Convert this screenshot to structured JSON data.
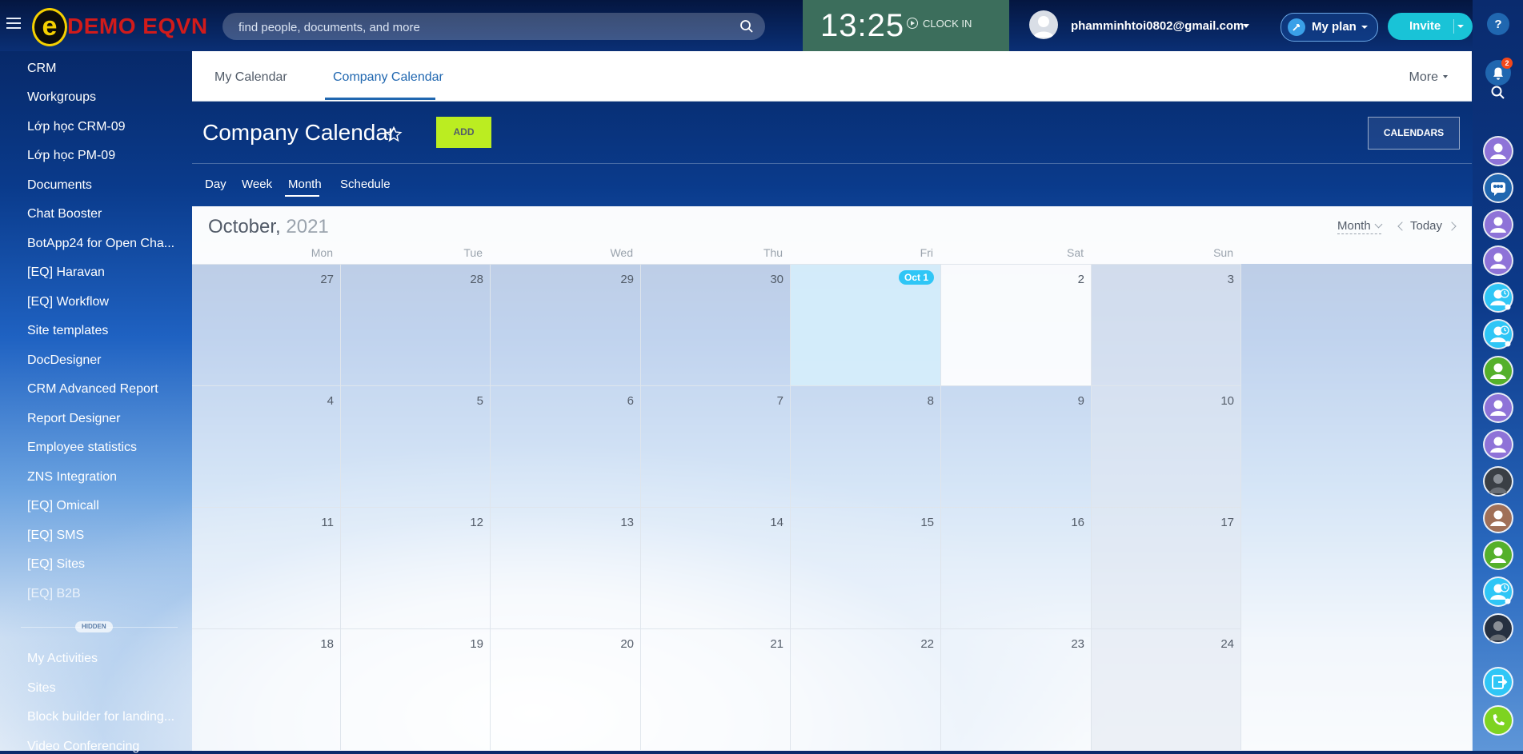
{
  "app": {
    "logo_letter": "e",
    "logo_text": "DEMO EQVN"
  },
  "search": {
    "placeholder": "find people, documents, and more"
  },
  "clock": {
    "time": "13:25",
    "clock_in_label": "CLOCK IN"
  },
  "user": {
    "email": "phamminhtoi0802@gmail.com"
  },
  "header_buttons": {
    "my_plan": "My plan",
    "invite": "Invite"
  },
  "sidebar": {
    "items": [
      {
        "label": "CRM"
      },
      {
        "label": "Workgroups"
      },
      {
        "label": "Lớp học CRM-09"
      },
      {
        "label": "Lớp học PM-09"
      },
      {
        "label": "Documents"
      },
      {
        "label": "Chat Booster"
      },
      {
        "label": "BotApp24 for Open Cha..."
      },
      {
        "label": "[EQ] Haravan"
      },
      {
        "label": "[EQ] Workflow"
      },
      {
        "label": "Site templates"
      },
      {
        "label": "DocDesigner"
      },
      {
        "label": "CRM Advanced Report"
      },
      {
        "label": "Report Designer"
      },
      {
        "label": "Employee statistics"
      },
      {
        "label": "ZNS Integration"
      },
      {
        "label": "[EQ] Omicall"
      },
      {
        "label": "[EQ] SMS"
      },
      {
        "label": "[EQ] Sites"
      },
      {
        "label": "[EQ] B2B"
      }
    ],
    "hidden_label": "HIDDEN",
    "hidden_items": [
      {
        "label": "My Activities"
      },
      {
        "label": "Sites"
      },
      {
        "label": "Block builder for landing..."
      },
      {
        "label": "Video Conferencing"
      }
    ]
  },
  "tabs": {
    "items": [
      {
        "label": "My Calendar"
      },
      {
        "label": "Company Calendar"
      }
    ],
    "more_label": "More"
  },
  "page": {
    "title": "Company Calendar",
    "add_label": "ADD",
    "calendars_label": "CALENDARS",
    "views": [
      {
        "label": "Day"
      },
      {
        "label": "Week"
      },
      {
        "label": "Month"
      },
      {
        "label": "Schedule"
      }
    ]
  },
  "calendar": {
    "month": "October,",
    "year": "2021",
    "mode": "Month",
    "today_label": "Today",
    "weekdays": [
      "Mon",
      "Tue",
      "Wed",
      "Thu",
      "Fri",
      "Sat",
      "Sun"
    ],
    "weeks": [
      [
        "27",
        "28",
        "29",
        "30",
        "Oct 1",
        "2",
        "3"
      ],
      [
        "4",
        "5",
        "6",
        "7",
        "8",
        "9",
        "10"
      ],
      [
        "11",
        "12",
        "13",
        "14",
        "15",
        "16",
        "17"
      ],
      [
        "18",
        "19",
        "20",
        "21",
        "22",
        "23",
        "24"
      ]
    ]
  },
  "rail": {
    "notification_count": "2",
    "colors": {
      "help": "#2067b0",
      "bell": "#2067b0",
      "purple": "#8e73d8",
      "cyan": "#2fc6f6",
      "green": "#55b02b",
      "brown": "#a07058",
      "phone": "#7ed321"
    }
  }
}
